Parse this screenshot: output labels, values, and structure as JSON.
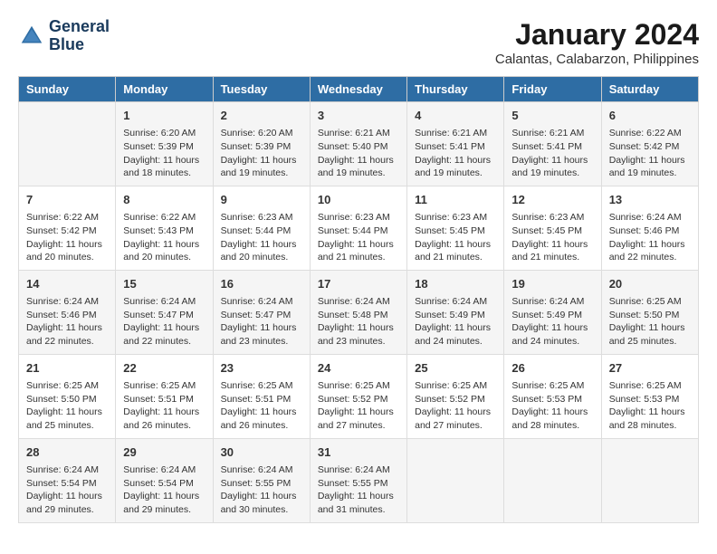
{
  "header": {
    "logo_line1": "General",
    "logo_line2": "Blue",
    "month": "January 2024",
    "location": "Calantas, Calabarzon, Philippines"
  },
  "columns": [
    "Sunday",
    "Monday",
    "Tuesday",
    "Wednesday",
    "Thursday",
    "Friday",
    "Saturday"
  ],
  "weeks": [
    [
      {
        "day": "",
        "content": ""
      },
      {
        "day": "1",
        "content": "Sunrise: 6:20 AM\nSunset: 5:39 PM\nDaylight: 11 hours\nand 18 minutes."
      },
      {
        "day": "2",
        "content": "Sunrise: 6:20 AM\nSunset: 5:39 PM\nDaylight: 11 hours\nand 19 minutes."
      },
      {
        "day": "3",
        "content": "Sunrise: 6:21 AM\nSunset: 5:40 PM\nDaylight: 11 hours\nand 19 minutes."
      },
      {
        "day": "4",
        "content": "Sunrise: 6:21 AM\nSunset: 5:41 PM\nDaylight: 11 hours\nand 19 minutes."
      },
      {
        "day": "5",
        "content": "Sunrise: 6:21 AM\nSunset: 5:41 PM\nDaylight: 11 hours\nand 19 minutes."
      },
      {
        "day": "6",
        "content": "Sunrise: 6:22 AM\nSunset: 5:42 PM\nDaylight: 11 hours\nand 19 minutes."
      }
    ],
    [
      {
        "day": "7",
        "content": "Sunrise: 6:22 AM\nSunset: 5:42 PM\nDaylight: 11 hours\nand 20 minutes."
      },
      {
        "day": "8",
        "content": "Sunrise: 6:22 AM\nSunset: 5:43 PM\nDaylight: 11 hours\nand 20 minutes."
      },
      {
        "day": "9",
        "content": "Sunrise: 6:23 AM\nSunset: 5:44 PM\nDaylight: 11 hours\nand 20 minutes."
      },
      {
        "day": "10",
        "content": "Sunrise: 6:23 AM\nSunset: 5:44 PM\nDaylight: 11 hours\nand 21 minutes."
      },
      {
        "day": "11",
        "content": "Sunrise: 6:23 AM\nSunset: 5:45 PM\nDaylight: 11 hours\nand 21 minutes."
      },
      {
        "day": "12",
        "content": "Sunrise: 6:23 AM\nSunset: 5:45 PM\nDaylight: 11 hours\nand 21 minutes."
      },
      {
        "day": "13",
        "content": "Sunrise: 6:24 AM\nSunset: 5:46 PM\nDaylight: 11 hours\nand 22 minutes."
      }
    ],
    [
      {
        "day": "14",
        "content": "Sunrise: 6:24 AM\nSunset: 5:46 PM\nDaylight: 11 hours\nand 22 minutes."
      },
      {
        "day": "15",
        "content": "Sunrise: 6:24 AM\nSunset: 5:47 PM\nDaylight: 11 hours\nand 22 minutes."
      },
      {
        "day": "16",
        "content": "Sunrise: 6:24 AM\nSunset: 5:47 PM\nDaylight: 11 hours\nand 23 minutes."
      },
      {
        "day": "17",
        "content": "Sunrise: 6:24 AM\nSunset: 5:48 PM\nDaylight: 11 hours\nand 23 minutes."
      },
      {
        "day": "18",
        "content": "Sunrise: 6:24 AM\nSunset: 5:49 PM\nDaylight: 11 hours\nand 24 minutes."
      },
      {
        "day": "19",
        "content": "Sunrise: 6:24 AM\nSunset: 5:49 PM\nDaylight: 11 hours\nand 24 minutes."
      },
      {
        "day": "20",
        "content": "Sunrise: 6:25 AM\nSunset: 5:50 PM\nDaylight: 11 hours\nand 25 minutes."
      }
    ],
    [
      {
        "day": "21",
        "content": "Sunrise: 6:25 AM\nSunset: 5:50 PM\nDaylight: 11 hours\nand 25 minutes."
      },
      {
        "day": "22",
        "content": "Sunrise: 6:25 AM\nSunset: 5:51 PM\nDaylight: 11 hours\nand 26 minutes."
      },
      {
        "day": "23",
        "content": "Sunrise: 6:25 AM\nSunset: 5:51 PM\nDaylight: 11 hours\nand 26 minutes."
      },
      {
        "day": "24",
        "content": "Sunrise: 6:25 AM\nSunset: 5:52 PM\nDaylight: 11 hours\nand 27 minutes."
      },
      {
        "day": "25",
        "content": "Sunrise: 6:25 AM\nSunset: 5:52 PM\nDaylight: 11 hours\nand 27 minutes."
      },
      {
        "day": "26",
        "content": "Sunrise: 6:25 AM\nSunset: 5:53 PM\nDaylight: 11 hours\nand 28 minutes."
      },
      {
        "day": "27",
        "content": "Sunrise: 6:25 AM\nSunset: 5:53 PM\nDaylight: 11 hours\nand 28 minutes."
      }
    ],
    [
      {
        "day": "28",
        "content": "Sunrise: 6:24 AM\nSunset: 5:54 PM\nDaylight: 11 hours\nand 29 minutes."
      },
      {
        "day": "29",
        "content": "Sunrise: 6:24 AM\nSunset: 5:54 PM\nDaylight: 11 hours\nand 29 minutes."
      },
      {
        "day": "30",
        "content": "Sunrise: 6:24 AM\nSunset: 5:55 PM\nDaylight: 11 hours\nand 30 minutes."
      },
      {
        "day": "31",
        "content": "Sunrise: 6:24 AM\nSunset: 5:55 PM\nDaylight: 11 hours\nand 31 minutes."
      },
      {
        "day": "",
        "content": ""
      },
      {
        "day": "",
        "content": ""
      },
      {
        "day": "",
        "content": ""
      }
    ]
  ]
}
